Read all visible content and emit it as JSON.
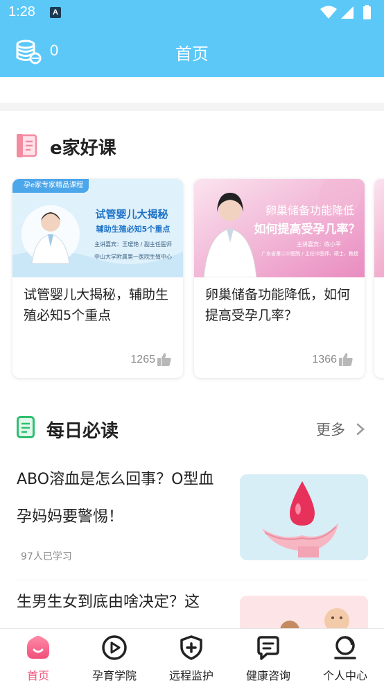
{
  "status_bar": {
    "time": "1:28",
    "notification_glyph": "A"
  },
  "header": {
    "coin_count": "0",
    "title": "首页"
  },
  "courses": {
    "title": "e家好课",
    "cards": [
      {
        "banner_tag": "孕e家专家精品课程",
        "banner_line1": "试管婴儿大揭秘",
        "banner_line2": "辅助生殖必知5个重点",
        "banner_speaker": "主讲嘉宾：王瑷艳 / 副主任医师",
        "banner_org": "中山大学附属第一医院生殖中心",
        "title": "试管婴儿大揭秘，辅助生殖必知5个重点",
        "likes": "1265"
      },
      {
        "banner_line1": "卵巢储备功能降低",
        "banner_line2": "如何提高受孕几率？",
        "banner_speaker": "主讲嘉宾：陈小平",
        "banner_org": "广东省第二中医院 / 主任中医师、硕士、教授",
        "title": "卵巢储备功能降低，如何提高受孕几率？",
        "likes": "1366"
      }
    ]
  },
  "daily": {
    "title": "每日必读",
    "more": "更多",
    "articles": [
      {
        "title": "ABO溶血是怎么回事？O型血孕妈妈要警惕！",
        "learners": "97人已学习"
      },
      {
        "title": "生男生女到底由啥决定？这"
      }
    ]
  },
  "nav": [
    {
      "label": "首页",
      "icon": "home-icon",
      "active": true
    },
    {
      "label": "孕育学院",
      "icon": "play-circle-icon"
    },
    {
      "label": "远程监护",
      "icon": "shield-plus-icon"
    },
    {
      "label": "健康咨询",
      "icon": "chat-icon"
    },
    {
      "label": "个人中心",
      "icon": "profile-icon"
    }
  ],
  "colors": {
    "header": "#5bc8f8",
    "accent": "#f05a7e",
    "course_icon": "#f38aa0",
    "daily_icon": "#2fbf71"
  }
}
